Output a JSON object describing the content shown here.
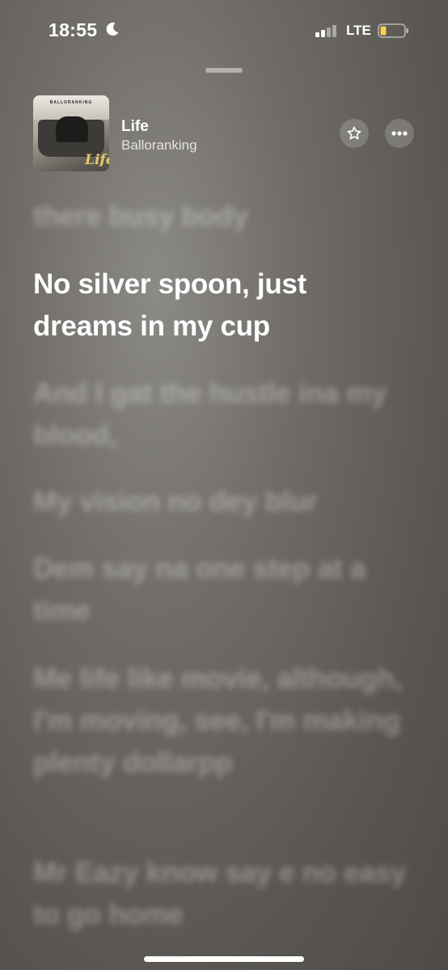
{
  "status_bar": {
    "time": "18:55",
    "network": "LTE",
    "icons": [
      "moon-icon",
      "signal-bars-icon",
      "battery-low-icon"
    ],
    "battery_color": "#f5d34f"
  },
  "now_playing": {
    "title": "Life",
    "artist": "Balloranking",
    "artwork_text": "BALLORANKING",
    "artwork_script": "Life",
    "buttons": [
      "star-icon",
      "ellipsis-icon"
    ]
  },
  "lyrics": [
    "there busy body",
    "No silver spoon, just dreams in my cup",
    "And I gat the hustle ina my blood,",
    "My vision no dey blur",
    "Dem say na one step at a time",
    "Me life like movie, although, I'm moving, see, I'm making plenty dollarpp",
    "Mr Eazy know say e no easy to go home"
  ],
  "current_lyric_index": 1
}
